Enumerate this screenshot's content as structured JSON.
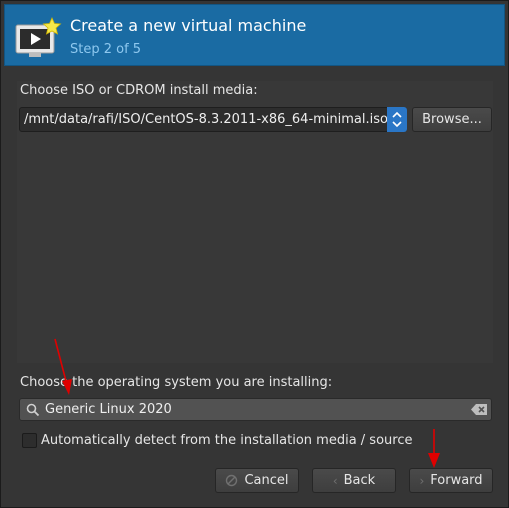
{
  "header": {
    "title": "Create a new virtual machine",
    "subtitle": "Step 2 of 5"
  },
  "media": {
    "label": "Choose ISO or CDROM install media:",
    "path": "/mnt/data/rafi/ISO/CentOS-8.3.2011-x86_64-minimal.iso",
    "browse_label": "Browse..."
  },
  "os": {
    "label": "Choose the operating system you are installing:",
    "search_value": "Generic Linux 2020",
    "autodetect_label": "Automatically detect from the installation media / source",
    "autodetect_checked": false
  },
  "buttons": {
    "cancel": "Cancel",
    "back": "Back",
    "forward": "Forward"
  },
  "icons": {
    "header": "virtual-machine-new-icon",
    "search": "search-icon",
    "clear": "clear-text-icon",
    "spin": "updown-spin-icon",
    "cancel": "cancel-icon",
    "back": "back-chevron-icon",
    "forward": "forward-chevron-icon"
  },
  "colors": {
    "header_bg": "#1a6ba3",
    "subtitle": "#8ec8ef",
    "annotation_arrow": "#e00000",
    "spin_button": "#2a76c6"
  }
}
